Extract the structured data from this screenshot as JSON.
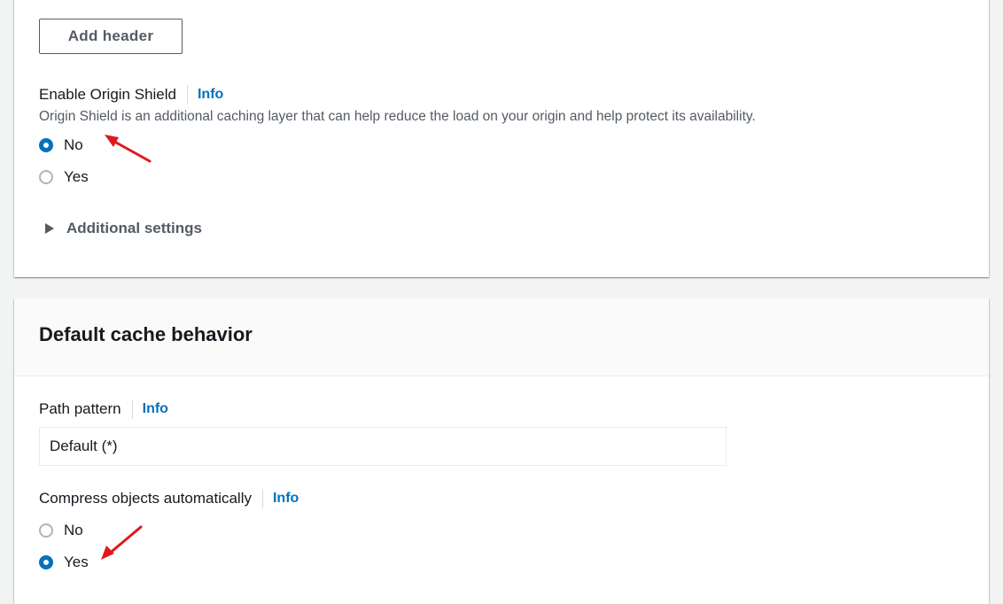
{
  "origin_section": {
    "add_header_label": "Add header",
    "origin_shield": {
      "label": "Enable Origin Shield",
      "info": "Info",
      "description": "Origin Shield is an additional caching layer that can help reduce the load on your origin and help protect its availability.",
      "options": [
        {
          "label": "No",
          "selected": true
        },
        {
          "label": "Yes",
          "selected": false
        }
      ]
    },
    "additional_settings_label": "Additional settings"
  },
  "cache_section": {
    "title": "Default cache behavior",
    "path_pattern": {
      "label": "Path pattern",
      "info": "Info",
      "value": "Default (*)"
    },
    "compress": {
      "label": "Compress objects automatically",
      "info": "Info",
      "options": [
        {
          "label": "No",
          "selected": false
        },
        {
          "label": "Yes",
          "selected": true
        }
      ]
    }
  },
  "colors": {
    "accent": "#0073bb",
    "annotation_arrow": "#e0191c"
  }
}
